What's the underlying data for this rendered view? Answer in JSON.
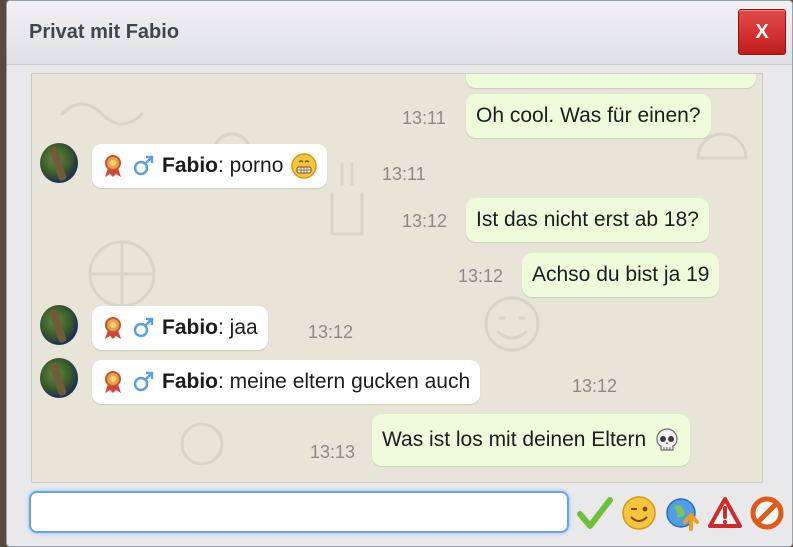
{
  "window": {
    "title": "Privat mit Fabio",
    "close_label": "X"
  },
  "messages": [
    {
      "side": "out",
      "time": "13:11",
      "text": "Oh cool. Was für einen?"
    },
    {
      "side": "in",
      "time": "13:11",
      "name": "Fabio",
      "text": ": porno",
      "emoji": "grin"
    },
    {
      "side": "out",
      "time": "13:12",
      "text": "Ist das nicht erst ab 18?"
    },
    {
      "side": "out",
      "time": "13:12",
      "text": "Achso du bist ja 19"
    },
    {
      "side": "in",
      "time": "13:12",
      "name": "Fabio",
      "text": ": jaa"
    },
    {
      "side": "in",
      "time": "13:12",
      "name": "Fabio",
      "text": ": meine eltern gucken auch"
    },
    {
      "side": "out",
      "time": "13:13",
      "text": "Was ist los mit deinen Eltern",
      "emoji": "skull"
    }
  ],
  "input": {
    "value": "",
    "placeholder": ""
  },
  "toolbar": {
    "send_icon": "check-icon",
    "emoji_icon": "smiley-wink-icon",
    "globe_icon": "globe-upload-icon",
    "report_icon": "warning-icon",
    "block_icon": "block-icon"
  },
  "colors": {
    "outgoing_bubble": "#eefcdc",
    "incoming_bubble": "#ffffff",
    "close_button": "#d73333",
    "input_focus": "#6aa4e6"
  }
}
